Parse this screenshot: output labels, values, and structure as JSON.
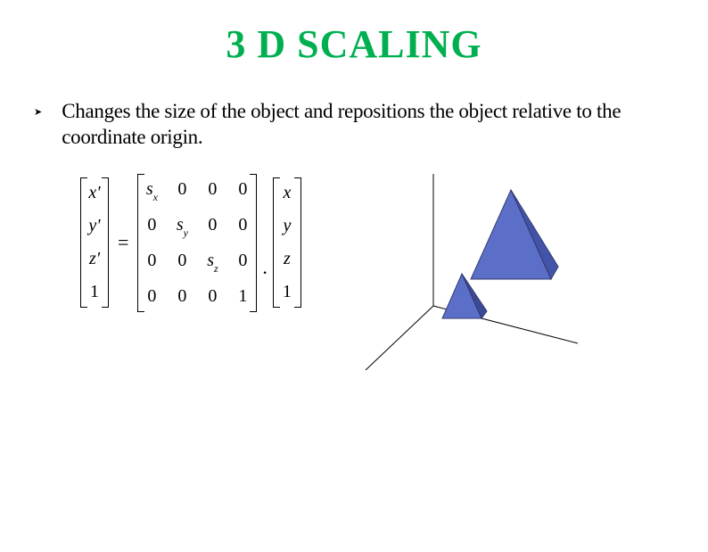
{
  "title": "3 D SCALING",
  "bullet": {
    "marker": "➤",
    "text": "Changes the size of the object and repositions the object relative to the coordinate origin."
  },
  "equation": {
    "lhs": [
      "x'",
      "y'",
      "z'",
      "1"
    ],
    "eq": "=",
    "matrix": [
      [
        "s_x",
        "0",
        "0",
        "0"
      ],
      [
        "0",
        "s_y",
        "0",
        "0"
      ],
      [
        "0",
        "0",
        "s_z",
        "0"
      ],
      [
        "0",
        "0",
        "0",
        "1"
      ]
    ],
    "dot": ".",
    "rhs": [
      "x",
      "y",
      "z",
      "1"
    ]
  }
}
